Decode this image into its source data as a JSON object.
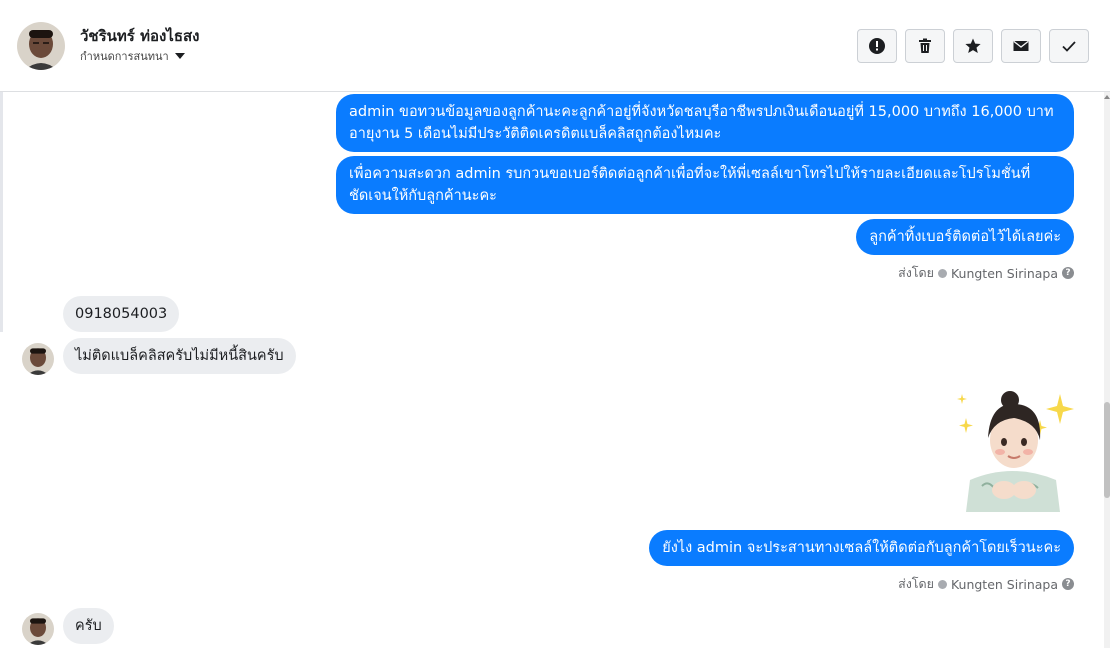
{
  "header": {
    "contact_name": "วัชรินทร์ ท่องไธสง",
    "subtitle": "กำหนดการสนทนา",
    "actions": [
      {
        "name": "report",
        "icon": "exclamation-circle-icon"
      },
      {
        "name": "delete",
        "icon": "trash-icon"
      },
      {
        "name": "star",
        "icon": "star-icon"
      },
      {
        "name": "mail",
        "icon": "envelope-icon"
      },
      {
        "name": "done",
        "icon": "checkmark-icon"
      }
    ]
  },
  "messages": [
    {
      "dir": "out",
      "text": "admin ขอทวนข้อมูลของลูกค้านะคะลูกค้าอยู่ที่จังหวัดชลบุรีอาชีพรปภเงินเดือนอยู่ที่ 15,000 บาทถึง 16,000 บาทอายุงาน 5 เดือนไม่มีประวัติติดเครดิตแบล็คลิสถูกต้องไหมคะ"
    },
    {
      "dir": "out",
      "text": "เพื่อความสะดวก admin รบกวนขอเบอร์ติดต่อลูกค้าเพื่อที่จะให้พี่เซลล์เขาโทรไปให้รายละเอียดและโปรโมชั่นที่ชัดเจนให้กับลูกค้านะคะ"
    },
    {
      "dir": "out",
      "text": "ลูกค้าทิ้งเบอร์ติดต่อไว้ได้เลยค่ะ"
    },
    {
      "dir": "in",
      "text": "0918054003"
    },
    {
      "dir": "in",
      "text": "ไม่ติดแบล็คลิสครับไม่มีหนี้สินครับ"
    },
    {
      "dir": "out",
      "text": "ยังไง admin จะประสานทางเซลล์ให้ติดต่อกับลูกค้าโดยเร็วนะคะ"
    },
    {
      "dir": "in",
      "text": "ครับ"
    }
  ],
  "sent_by": {
    "prefix": "ส่งโดย",
    "agent": "Kungten Sirinapa"
  },
  "colors": {
    "outgoing_bubble": "#0a7cff",
    "incoming_bubble": "#ebedf0"
  }
}
